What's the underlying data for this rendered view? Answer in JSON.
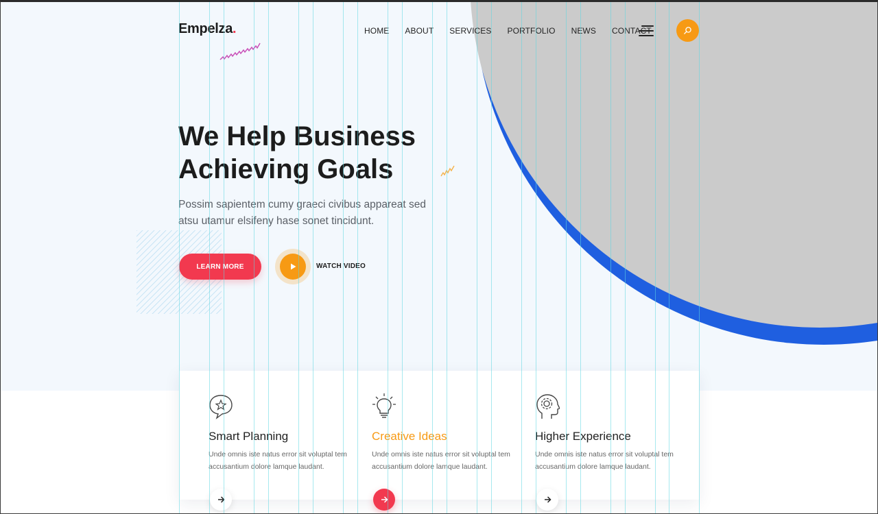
{
  "header": {
    "logo_text": "Empelza",
    "logo_dot": ".",
    "nav": [
      "HOME",
      "ABOUT",
      "SERVICES",
      "PORTFOLIO",
      "NEWS",
      "CONTACT"
    ],
    "menu_icon": "hamburger-icon",
    "search_icon": "search-icon"
  },
  "hero": {
    "title_line1": "We Help Business",
    "title_line2": "Achieving Goals",
    "description": "Possim sapientem cumy graeci civibus appareat sed atsu utamur elsifeny hase sonet tincidunt.",
    "learn_more_label": "LEARN MORE",
    "watch_video_label": "WATCH VIDEO",
    "play_icon": "play-icon"
  },
  "features": [
    {
      "icon": "chat-star-icon",
      "title": "Smart Planning",
      "text": "Unde omnis iste natus error sit voluptal tem accusantium dolore lamque laudant.",
      "arrow_icon": "arrow-right-icon"
    },
    {
      "icon": "lightbulb-icon",
      "title": "Creative Ideas",
      "text": "Unde omnis iste natus error sit voluptal tem accusantium dolore lamque laudant.",
      "arrow_icon": "arrow-right-icon"
    },
    {
      "icon": "head-gear-icon",
      "title": "Higher Experience",
      "text": "Unde omnis iste natus error sit voluptal tem accusantium dolore lamque laudant.",
      "arrow_icon": "arrow-right-icon"
    }
  ],
  "colors": {
    "accent_red": "#f2394f",
    "accent_orange": "#f79a14",
    "ring_blue": "#1f5fe0",
    "placeholder_grey": "#cbcbcb",
    "hero_background": "#f3f8fd",
    "guide_cyan": "#5fd7e1"
  }
}
